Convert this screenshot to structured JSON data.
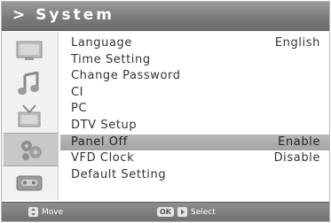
{
  "header": {
    "title": "> System"
  },
  "sidebar": {
    "items": [
      {
        "icon": "tv-screen-icon",
        "selected": false
      },
      {
        "icon": "music-notes-icon",
        "selected": false
      },
      {
        "icon": "antenna-tv-icon",
        "selected": false
      },
      {
        "icon": "gear-cluster-icon",
        "selected": true
      },
      {
        "icon": "cassette-icon",
        "selected": false
      }
    ]
  },
  "menu": {
    "items": [
      {
        "label": "Language",
        "value": "English",
        "selected": false
      },
      {
        "label": "Time Setting",
        "value": "",
        "selected": false
      },
      {
        "label": "Change Password",
        "value": "",
        "selected": false
      },
      {
        "label": "CI",
        "value": "",
        "selected": false
      },
      {
        "label": "PC",
        "value": "",
        "selected": false
      },
      {
        "label": "DTV Setup",
        "value": "",
        "selected": false
      },
      {
        "label": "Panel Off",
        "value": "Enable",
        "selected": true
      },
      {
        "label": "VFD Clock",
        "value": "Disable",
        "selected": false
      },
      {
        "label": "Default Setting",
        "value": "",
        "selected": false
      }
    ]
  },
  "footer": {
    "move_label": "Move",
    "ok_key": "OK",
    "select_label": "Select"
  },
  "colors": {
    "title_bar": "#7a7a7a",
    "highlight": "#aaaaaa",
    "text": "#333333"
  }
}
